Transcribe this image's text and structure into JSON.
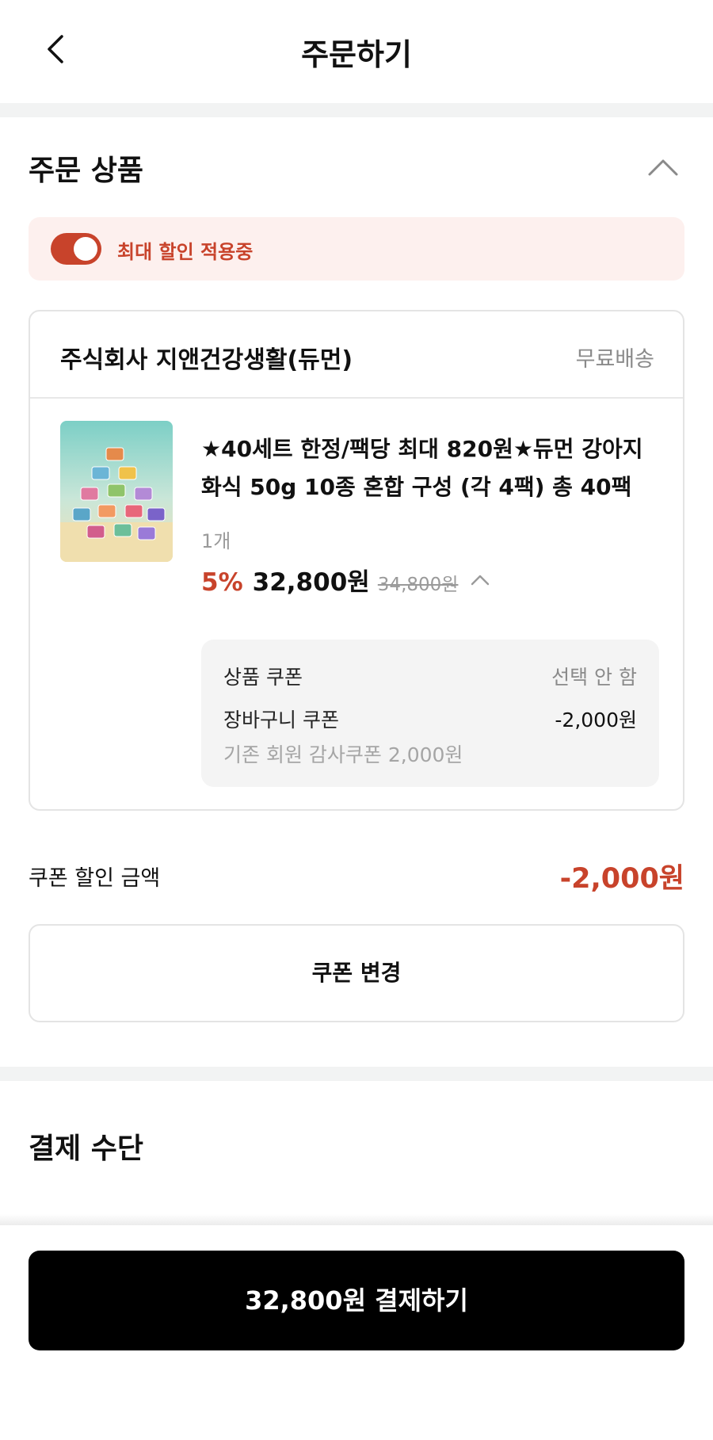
{
  "header": {
    "title": "주문하기",
    "back_icon": "chevron-left-icon"
  },
  "order_section": {
    "title": "주문 상품",
    "collapse_icon": "chevron-up-icon",
    "promo": {
      "toggle_on": true,
      "label": "최대 할인 적용중",
      "accent_color": "#c8432b",
      "bg_color": "#fdf0ee"
    }
  },
  "seller": {
    "name": "주식회사 지앤건강생활(듀먼)",
    "shipping": "무료배송",
    "product": {
      "name": "★40세트 한정/팩당 최대 820원★듀먼 강아지화식 50g 10종 혼합 구성 (각 4팩) 총 40팩",
      "qty": "1개",
      "discount_rate": "5%",
      "price": "32,800원",
      "original_price": "34,800원",
      "price_toggle_icon": "chevron-up-icon",
      "coupons": {
        "product_coupon_label": "상품 쿠폰",
        "product_coupon_value": "선택 안 함",
        "cart_coupon_label": "장바구니 쿠폰",
        "cart_coupon_value": "-2,000원",
        "cart_coupon_desc": "기존 회원 감사쿠폰 2,000원"
      }
    }
  },
  "coupon_discount": {
    "label": "쿠폰 할인 금액",
    "value": "-2,000원"
  },
  "change_coupon_button": "쿠폰 변경",
  "payment_section": {
    "title": "결제 수단"
  },
  "pay_button": "32,800원 결제하기"
}
